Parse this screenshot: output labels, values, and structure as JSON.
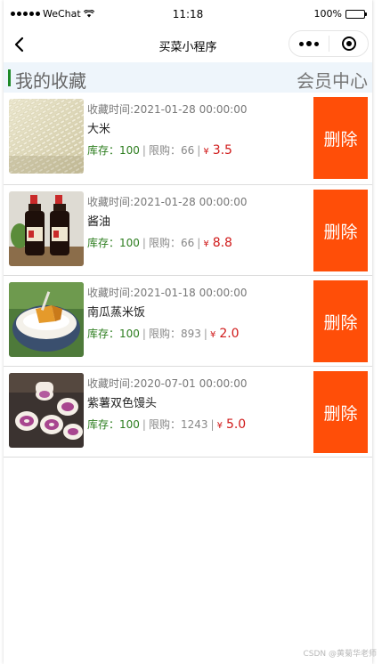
{
  "status_bar": {
    "carrier": "WeChat",
    "time": "11:18",
    "battery": "100%",
    "battery_level": 1.0
  },
  "nav": {
    "title": "买菜小程序",
    "back_icon": "chevron-left-icon",
    "more_icon": "more-dots-icon",
    "close_icon": "target-circle-icon"
  },
  "header": {
    "title": "我的收藏",
    "vip_link": "会员中心"
  },
  "labels": {
    "fav_time_prefix": "收藏时间:",
    "stock_prefix": "库存：",
    "limit_prefix": "限购：",
    "sep": "|",
    "yen": "¥",
    "delete": "删除"
  },
  "favorites": [
    {
      "fav_time": "2021-01-28 00:00:00",
      "name": "大米",
      "stock": "100",
      "limit": "66",
      "price": "3.5",
      "image": "rice-photo"
    },
    {
      "fav_time": "2021-01-28 00:00:00",
      "name": "酱油",
      "stock": "100",
      "limit": "66",
      "price": "8.8",
      "image": "soy-sauce-photo"
    },
    {
      "fav_time": "2021-01-18 00:00:00",
      "name": "南瓜蒸米饭",
      "stock": "100",
      "limit": "893",
      "price": "2.0",
      "image": "pumpkin-rice-photo"
    },
    {
      "fav_time": "2020-07-01 00:00:00",
      "name": "紫薯双色馒头",
      "stock": "100",
      "limit": "1243",
      "price": "5.0",
      "image": "purple-potato-bun-photo"
    }
  ],
  "colors": {
    "accent_green": "#1f8a28",
    "delete_orange": "#ff4e08",
    "price_red": "#d01a1a",
    "header_band": "#eef5fb"
  },
  "watermark": "CSDN @黄菊华老师"
}
